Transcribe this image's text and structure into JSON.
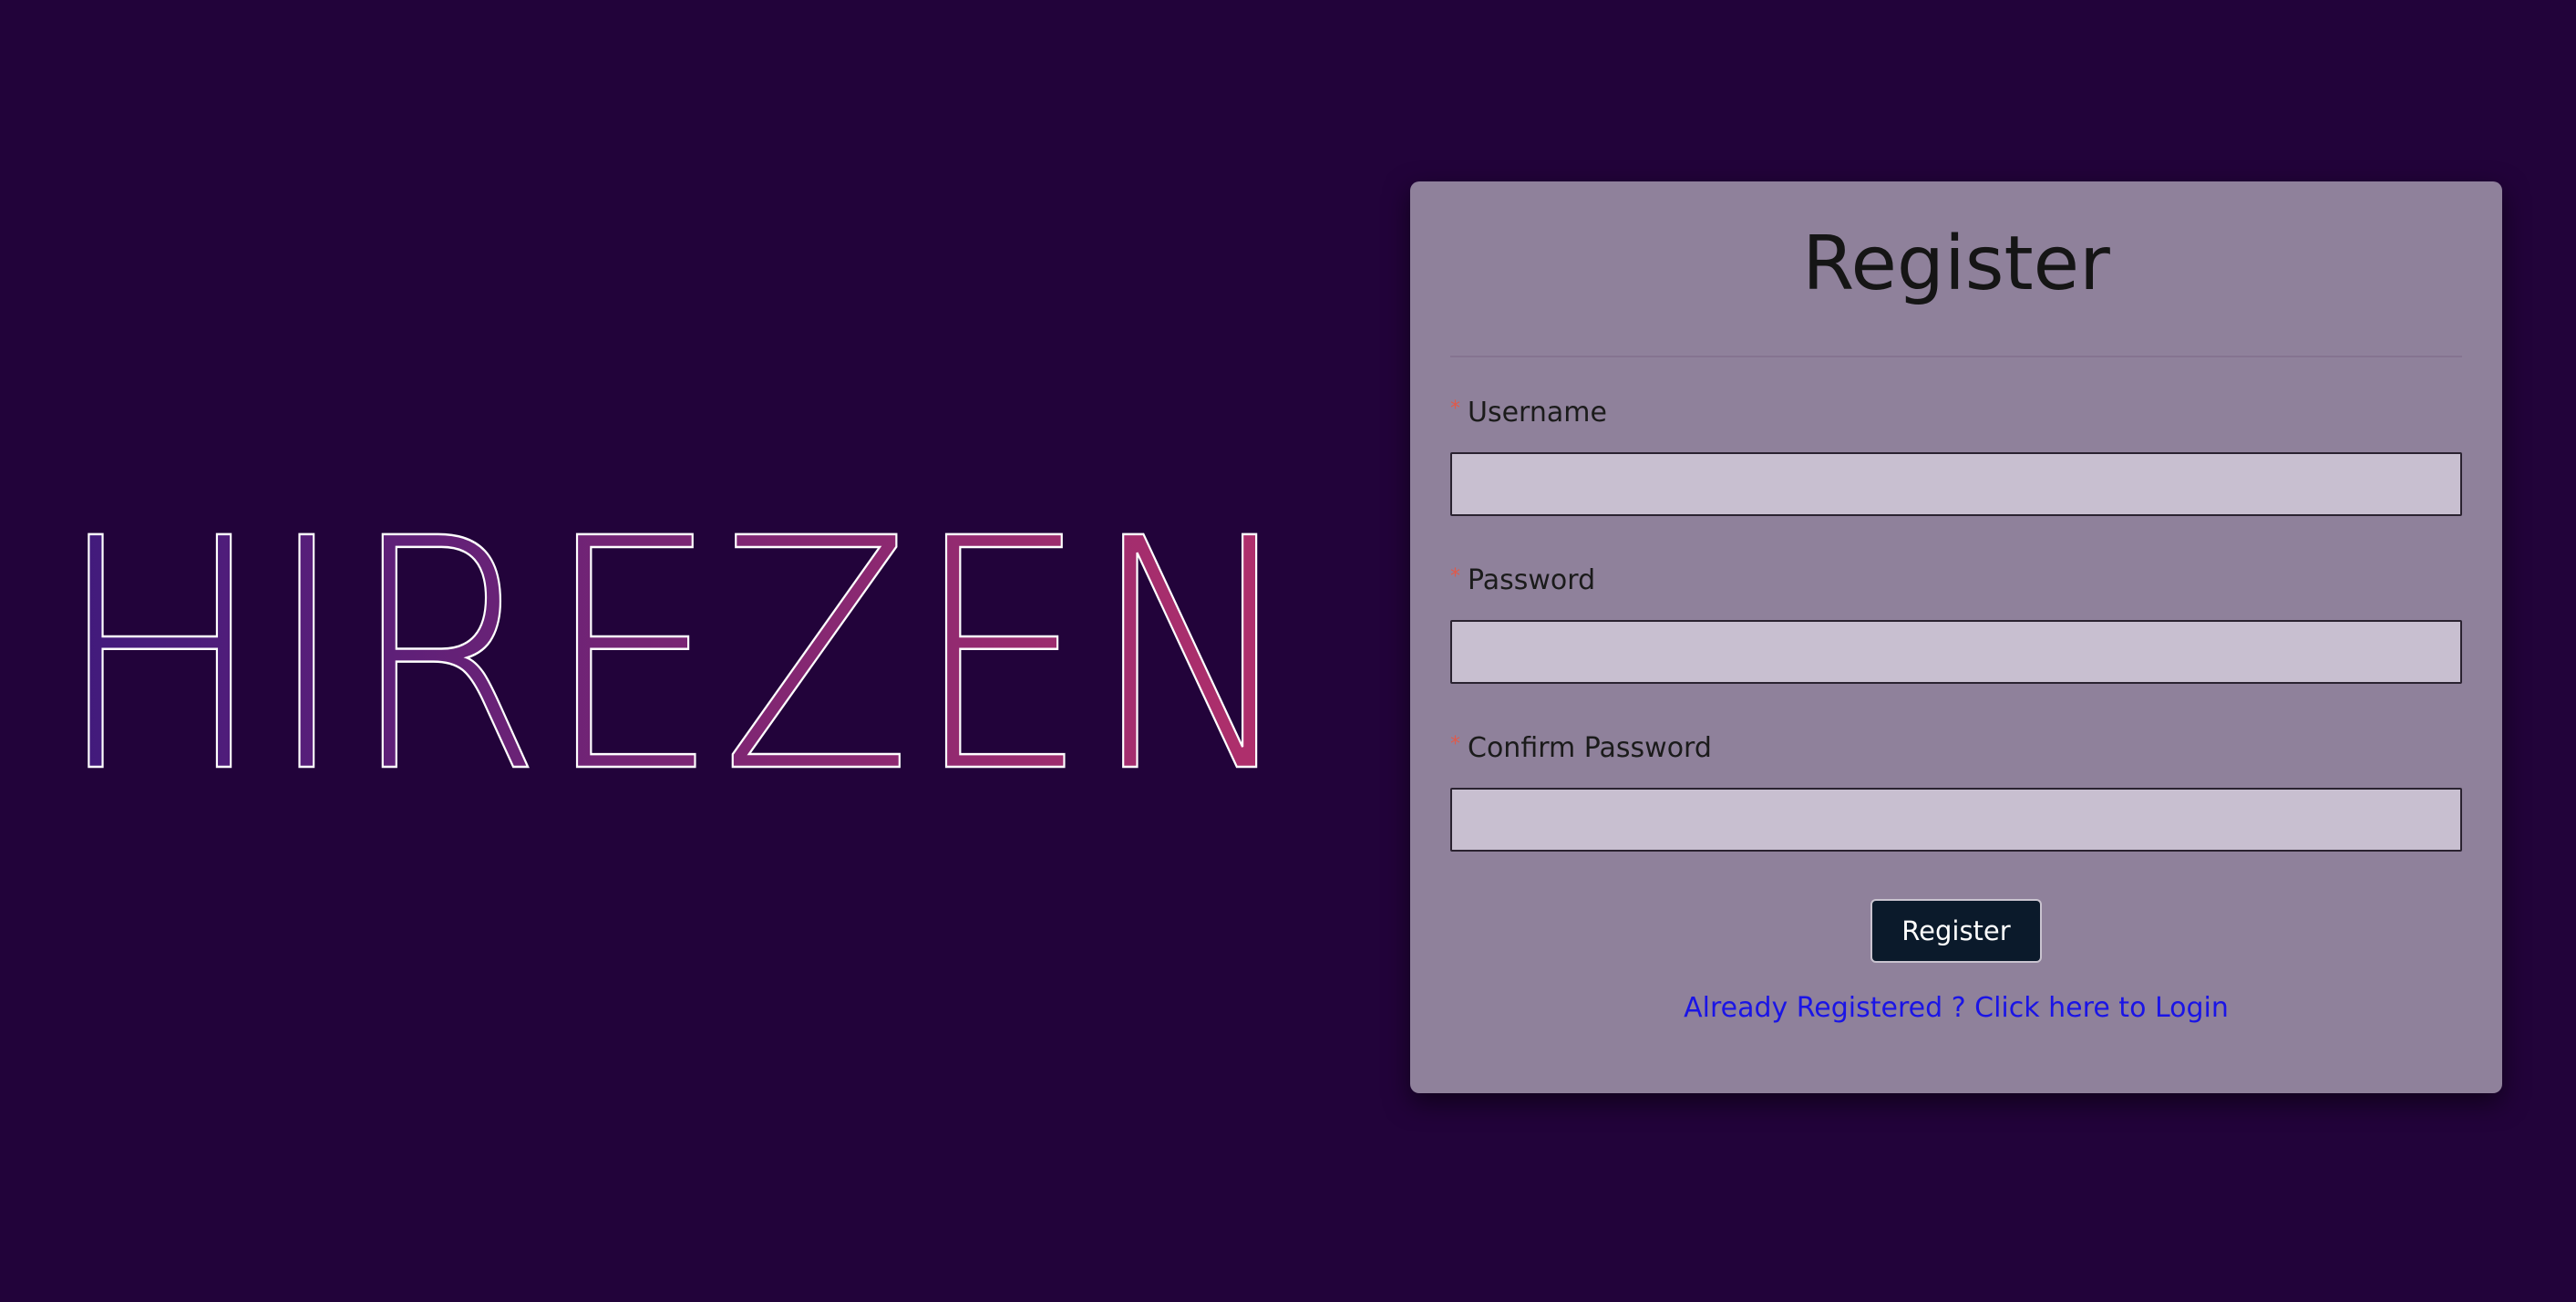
{
  "logo": {
    "text": "HIREZEN",
    "gradient_start": "#3f1a7d",
    "gradient_end": "#b3306b"
  },
  "register_form": {
    "title": "Register",
    "fields": [
      {
        "label": "Username",
        "required_mark": "*",
        "value": ""
      },
      {
        "label": "Password",
        "required_mark": "*",
        "value": ""
      },
      {
        "label": "Confirm Password",
        "required_mark": "*",
        "value": ""
      }
    ],
    "submit_label": "Register",
    "login_link": "Already Registered ? Click here to Login"
  },
  "colors": {
    "background": "#22033a",
    "card": "#8f819b",
    "input": "#c8bfd0",
    "button": "#0b1a2b",
    "link": "#1a14e6",
    "required": "#e05a4a"
  }
}
